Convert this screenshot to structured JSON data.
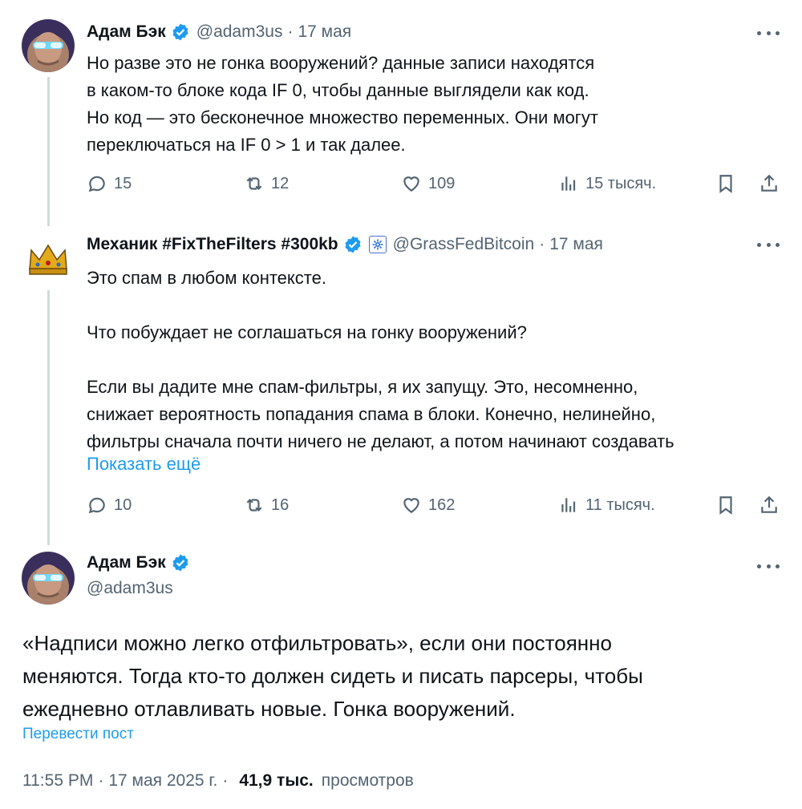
{
  "tweet1": {
    "name": "Адам Бэк",
    "handle": "@adam3us",
    "dot": "·",
    "date": "17 мая",
    "text": "Но разве это не гонка вооружений? данные записи находятся\nв каком-то блоке кода IF 0, чтобы данные выглядели как код.\nНо код — это бесконечное множество переменных. Они могут\nпереключаться на IF 0 > 1 и так далее.",
    "replies": "15",
    "reposts": "12",
    "likes": "109",
    "views": "15 тысяч.",
    "avatar_icon": "avatar-adam-icon"
  },
  "tweet2": {
    "name": "Механик #FixTheFilters #300kb",
    "handle": "@GrassFedBitcoin",
    "dot": "·",
    "date": "17 мая",
    "text": "Это спам в любом контексте.\n\nЧто побуждает не соглашаться на гонку вооружений?\n\nЕсли вы дадите мне спам-фильтры, я их запущу. Это, несомненно,\nснижает вероятность попадания спама в блоки. Конечно, нелинейно,\nфильтры сначала почти ничего не делают, а потом начинают создавать",
    "show_more": "Показать ещё",
    "replies": "10",
    "reposts": "16",
    "likes": "162",
    "views": "11 тысяч.",
    "avatar_icon": "crown-avatar-icon"
  },
  "main": {
    "name": "Адам Бэк",
    "handle": "@adam3us",
    "text": "«Надписи можно легко отфильтровать», если они постоянно\nменяются. Тогда кто-то должен сидеть и писать парсеры, чтобы\nежедневно отлавливать новые. Гонка вооружений.",
    "translate": "Перевести пост",
    "time": "11:55 PM",
    "sep1": "·",
    "date": "17 мая 2025 г.",
    "sep2": "·",
    "views_count": "41,9 тыс.",
    "views_label": "просмотров"
  },
  "colors": {
    "accent": "#1d9bf0",
    "secondary_text": "#536471",
    "thread_line": "#cfd9de"
  }
}
